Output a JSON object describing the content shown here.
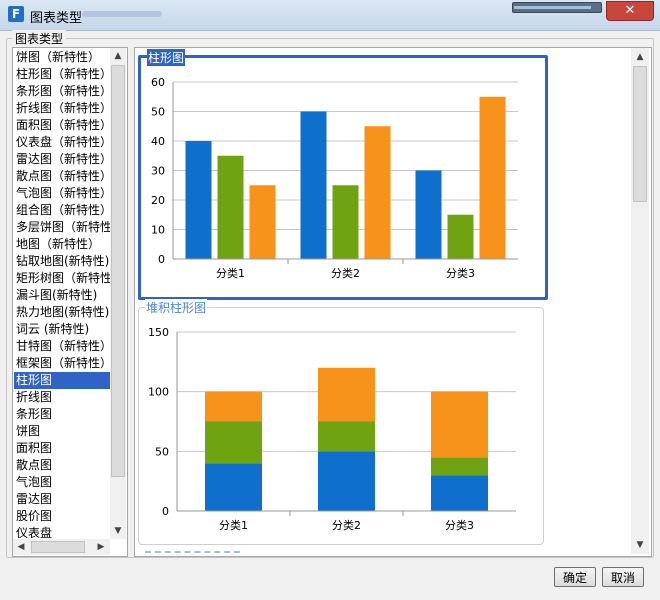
{
  "window": {
    "title": "图表类型",
    "progress": 0.9
  },
  "group_label": "图表类型",
  "chart_types": [
    "饼图（新特性）",
    "柱形图（新特性）",
    "条形图（新特性）",
    "折线图（新特性）",
    "面积图（新特性）",
    "仪表盘（新特性）",
    "雷达图（新特性）",
    "散点图（新特性）",
    "气泡图（新特性）",
    "组合图（新特性）",
    "多层饼图（新特性）",
    "地图（新特性）",
    "钻取地图(新特性)",
    "矩形树图（新特性）",
    "漏斗图(新特性)",
    "热力地图(新特性)",
    "词云 (新特性)",
    "甘特图（新特性）",
    "框架图（新特性）",
    "柱形图",
    "折线图",
    "条形图",
    "饼图",
    "面积图",
    "散点图",
    "气泡图",
    "雷达图",
    "股价图",
    "仪表盘"
  ],
  "selected_index": 19,
  "chart_data": [
    {
      "type": "bar",
      "title": "柱形图",
      "categories": [
        "分类1",
        "分类2",
        "分类3"
      ],
      "series": [
        {
          "values": [
            40,
            50,
            30
          ],
          "color": "#0e6fcc"
        },
        {
          "values": [
            35,
            25,
            15
          ],
          "color": "#6fa312"
        },
        {
          "values": [
            25,
            45,
            55
          ],
          "color": "#f7931a"
        }
      ],
      "ylim": [
        0,
        60
      ],
      "yticks": [
        "0",
        "10",
        "20",
        "30",
        "40",
        "50",
        "60"
      ],
      "grid": true
    },
    {
      "type": "stacked_bar",
      "title": "堆积柱形图",
      "categories": [
        "分类1",
        "分类2",
        "分类3"
      ],
      "series": [
        {
          "values": [
            40,
            50,
            30
          ],
          "color": "#0e6fcc"
        },
        {
          "values": [
            35,
            25,
            15
          ],
          "color": "#6fa312"
        },
        {
          "values": [
            25,
            45,
            55
          ],
          "color": "#f7931a"
        }
      ],
      "ylim": [
        0,
        150
      ],
      "yticks": [
        "0",
        "50",
        "100",
        "150"
      ],
      "grid": true
    }
  ],
  "buttons": {
    "ok": "确定",
    "cancel": "取消"
  },
  "icons": {
    "app": "app-logo-icon",
    "close": "close-icon",
    "scroll_up": "arrow-up-icon",
    "scroll_down": "arrow-down-icon",
    "scroll_left": "arrow-left-icon",
    "scroll_right": "arrow-right-icon"
  }
}
